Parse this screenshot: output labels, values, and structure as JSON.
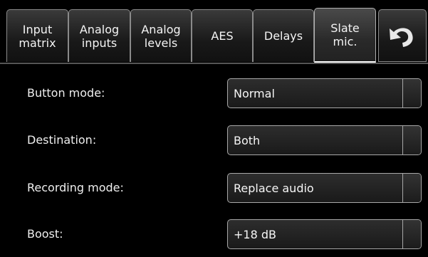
{
  "tabs": [
    {
      "label": "Input\nmatrix"
    },
    {
      "label": "Analog\ninputs"
    },
    {
      "label": "Analog\nlevels"
    },
    {
      "label": "AES"
    },
    {
      "label": "Delays"
    },
    {
      "label": "Slate\nmic.",
      "active": true
    }
  ],
  "undo": {
    "icon": "undo-icon"
  },
  "settings": [
    {
      "label": "Button mode:",
      "value": "Normal"
    },
    {
      "label": "Destination:",
      "value": "Both"
    },
    {
      "label": "Recording mode:",
      "value": "Replace audio"
    },
    {
      "label": "Boost:",
      "value": "+18 dB"
    }
  ],
  "colors": {
    "background": "#000000",
    "text": "#f2f2f2",
    "border": "#a8a8a8"
  }
}
